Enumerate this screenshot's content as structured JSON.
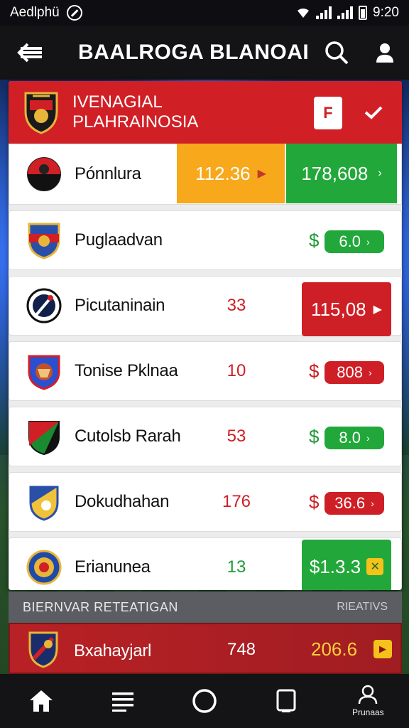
{
  "status_bar": {
    "carrier": "Aedlphü",
    "time": "9:20"
  },
  "header": {
    "title": "BAALROGA BLANOAI"
  },
  "league": {
    "line1": "IVENAGIAL",
    "line2": "PLAHRAINOSIA",
    "filter_label": "F"
  },
  "teams": [
    {
      "name": "Pónnlura",
      "tile_left": "112.36",
      "tile_right": "178,608"
    },
    {
      "name": "Puglaadvan",
      "value": "",
      "pill": "6.0"
    },
    {
      "name": "Picutaninain",
      "value": "33",
      "tile": "115,08"
    },
    {
      "name": "Tonise Pklnaa",
      "value": "10",
      "pill": "808"
    },
    {
      "name": "Cutolsb Rarah",
      "value": "53",
      "pill": "8.0"
    },
    {
      "name": "Dokudhahan",
      "value": "176",
      "pill": "36.6"
    },
    {
      "name": "Erianunea",
      "value": "13",
      "tile": "$1.3.3"
    }
  ],
  "section": {
    "title": "BIERNVAR RETEATIGAN",
    "link": "RIEATIVS",
    "row": {
      "name": "Bxahayjarl",
      "value": "748",
      "highlight": "206.6"
    }
  },
  "bottom_nav": {
    "profile_label": "Prunaas"
  },
  "colors": {
    "accent_red": "#d11f26",
    "accent_green": "#21a83a",
    "accent_yellow": "#f5a81c"
  }
}
